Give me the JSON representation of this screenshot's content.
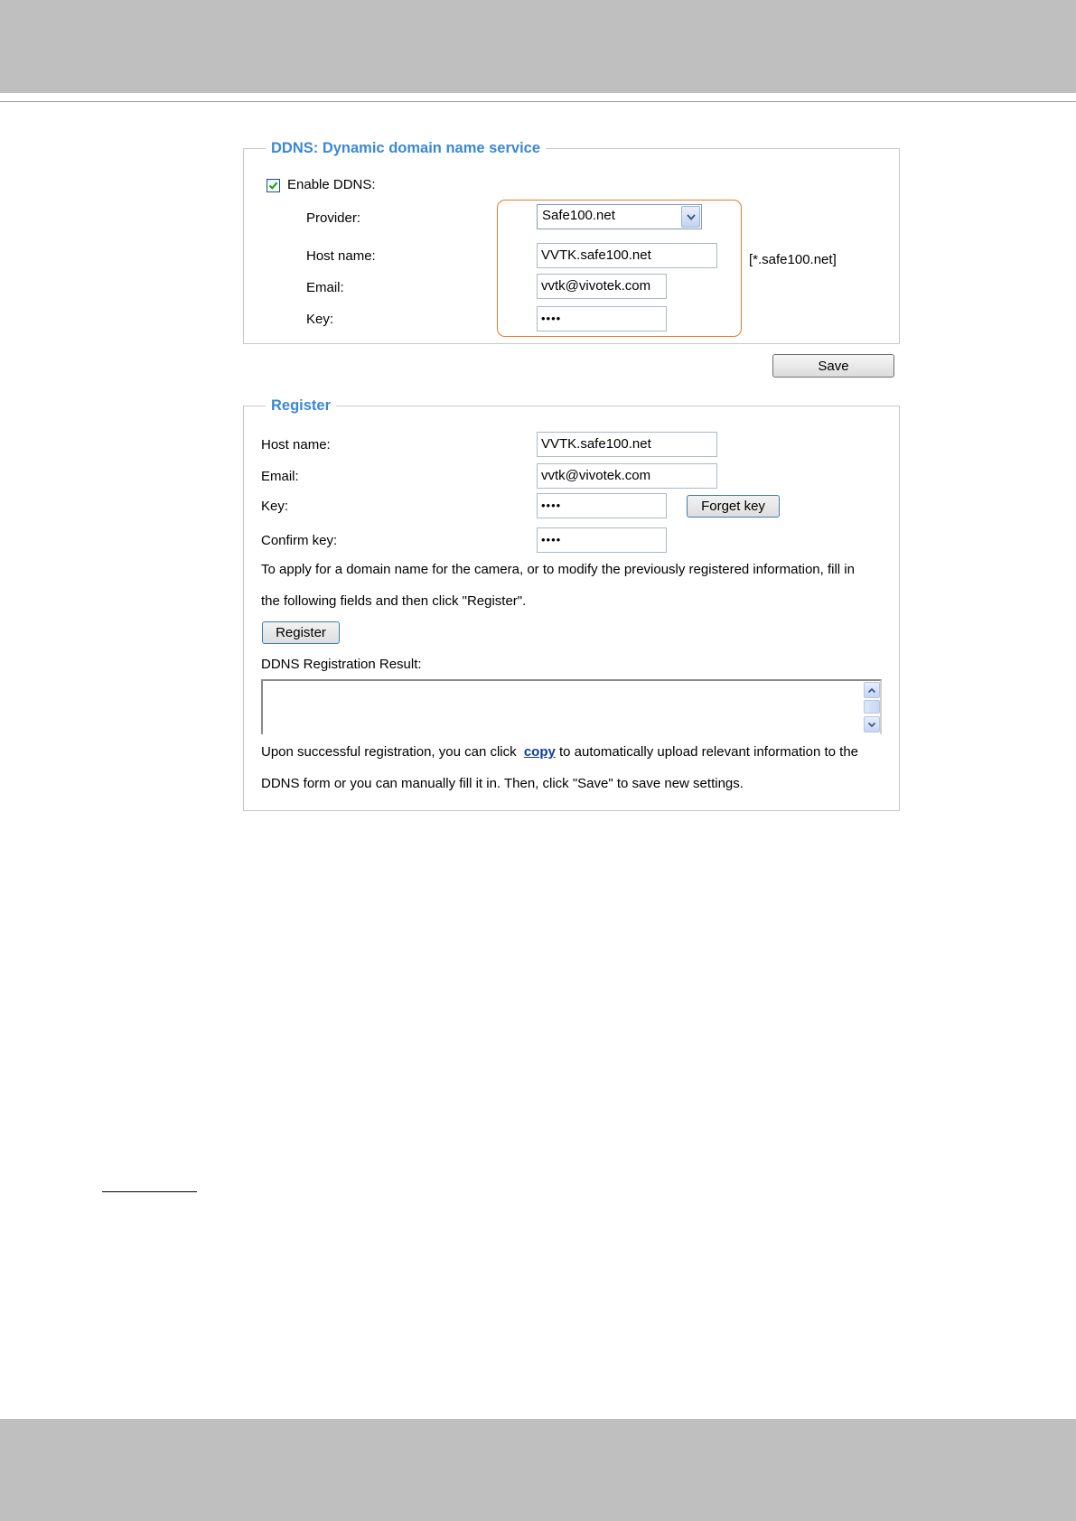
{
  "ddns": {
    "legend": "DDNS: Dynamic domain name service",
    "enable_label": "Enable DDNS:",
    "enable_checked": true,
    "provider_label": "Provider:",
    "provider_value": "Safe100.net",
    "hostname_label": "Host name:",
    "hostname_value": "VVTK.safe100.net",
    "hostname_suffix": "[*.safe100.net]",
    "email_label": "Email:",
    "email_value": "vvtk@vivotek.com",
    "key_label": "Key:",
    "key_value": "••••",
    "highlight_color": "#e97a2a"
  },
  "save_label": "Save",
  "register": {
    "legend": "Register",
    "hostname_label": "Host name:",
    "hostname_value": "VVTK.safe100.net",
    "email_label": "Email:",
    "email_value": "vvtk@vivotek.com",
    "key_label": "Key:",
    "key_value": "••••",
    "forget_key_label": "Forget key",
    "confirm_key_label": "Confirm key:",
    "confirm_key_value": "••••",
    "instruction_line1": "To apply for a domain name for the camera, or to modify the previously registered information, fill in",
    "instruction_line2": "the following fields and then click \"Register\".",
    "register_button_label": "Register",
    "result_label": "DDNS Registration Result:",
    "result_value": "",
    "upon_prefix": "Upon successful registration, you can click",
    "copy_link": "copy",
    "upon_suffix": "to automatically upload relevant information to the",
    "upon_line2": "DDNS form or you can manually fill it in. Then, click \"Save\" to save new settings."
  },
  "colors": {
    "page_band": "#bebfbe",
    "legend": "#3b88d2",
    "link": "#0e3b9c"
  }
}
